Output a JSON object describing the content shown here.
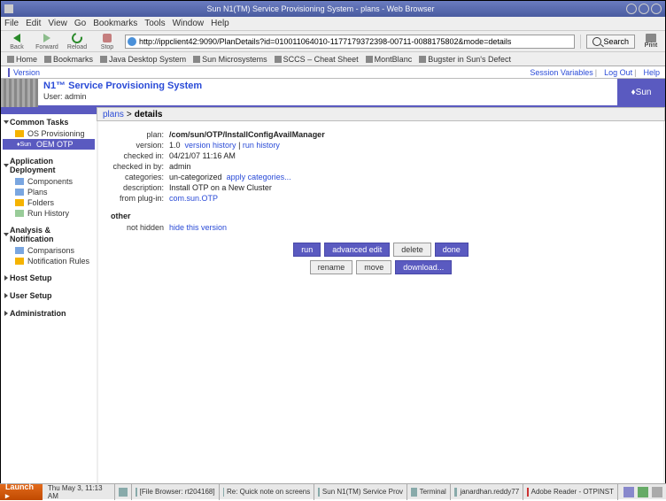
{
  "window": {
    "title": "Sun N1(TM) Service Provisioning System - plans - Web Browser"
  },
  "menubar": [
    "File",
    "Edit",
    "View",
    "Go",
    "Bookmarks",
    "Tools",
    "Window",
    "Help"
  ],
  "nav": {
    "back": "Back",
    "forward": "Forward",
    "reload": "Reload",
    "stop": "Stop",
    "url": "http://ippclient42:9090/PlanDetails?id=010011064010-1177179372398-00711-0088175802&mode=details",
    "search": "Search",
    "print": "Print"
  },
  "bookmarks": [
    "Home",
    "Bookmarks",
    "Java Desktop System",
    "Sun Microsystems",
    "SCCS – Cheat Sheet",
    "MontBlanc",
    "Bugster in Sun's Defect"
  ],
  "topbar": {
    "version": "Version",
    "session": "Session Variables",
    "logout": "Log Out",
    "help": "Help"
  },
  "header": {
    "title": "N1™ Service Provisioning System",
    "user_label": "User:",
    "user": "admin",
    "sun": "♦Sun"
  },
  "sidebar": {
    "s1": {
      "hdr": "Common Tasks",
      "items": [
        {
          "label": "OS Provisioning"
        },
        {
          "label": "OEM OTP",
          "sel": true,
          "sun": true
        }
      ]
    },
    "s2": {
      "hdr": "Application Deployment",
      "items": [
        {
          "label": "Components"
        },
        {
          "label": "Plans"
        },
        {
          "label": "Folders"
        },
        {
          "label": "Run History"
        }
      ]
    },
    "s3": {
      "hdr": "Analysis & Notification",
      "items": [
        {
          "label": "Comparisons"
        },
        {
          "label": "Notification Rules"
        }
      ]
    },
    "s4": {
      "hdr": "Host Setup"
    },
    "s5": {
      "hdr": "User Setup"
    },
    "s6": {
      "hdr": "Administration"
    }
  },
  "breadcrumb": {
    "root": "plans",
    "sep": ">",
    "cur": "details"
  },
  "details": {
    "plan_k": "plan:",
    "plan_v": "/com/sun/OTP/InstallConfigAvailManager",
    "ver_k": "version:",
    "ver_v": "1.0",
    "ver_hist": "version history",
    "run_hist": "run history",
    "chk_k": "checked in:",
    "chk_v": "04/21/07 11:16 AM",
    "by_k": "checked in by:",
    "by_v": "admin",
    "cat_k": "categories:",
    "cat_v": "un-categorized",
    "cat_link": "apply categories...",
    "desc_k": "description:",
    "desc_v": "Install OTP on a New Cluster",
    "plg_k": "from plug-in:",
    "plg_link": "com.sun.OTP",
    "other_hdr": "other",
    "nh_k": "not hidden",
    "nh_link": "hide this version"
  },
  "buttons": {
    "run": "run",
    "adv": "advanced edit",
    "del": "delete",
    "done": "done",
    "ren": "rename",
    "mov": "move",
    "dl": "download..."
  },
  "taskbar": {
    "launch": "Launch ▸",
    "clock": "Thu May  3, 11:13 AM",
    "items": [
      "[File Browser: rt204168]",
      "Re: Quick note on screens",
      "Sun N1(TM) Service Prov",
      "Terminal",
      "janardhan.reddy77",
      "Adobe Reader - OTPINST"
    ]
  }
}
